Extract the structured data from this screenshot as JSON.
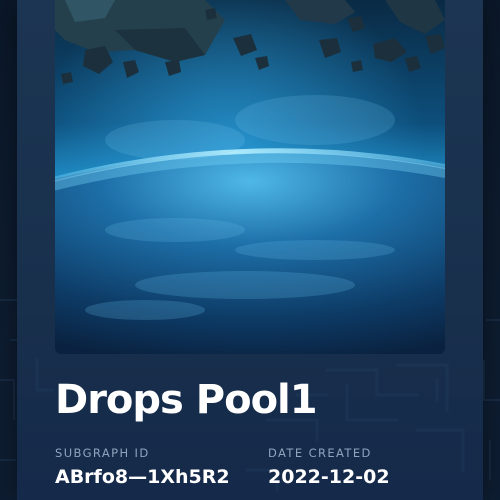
{
  "pool": {
    "name": "Drops Pool1",
    "subgraph_id_label": "SUBGRAPH ID",
    "subgraph_id": "ABrfo8—1Xh5R2",
    "date_created_label": "DATE CREATED",
    "date_created": "2022-12-02"
  },
  "colors": {
    "background": "#0d1b2e",
    "card": "#1a3250",
    "label": "#8ea4bd",
    "title": "#ffffff"
  }
}
